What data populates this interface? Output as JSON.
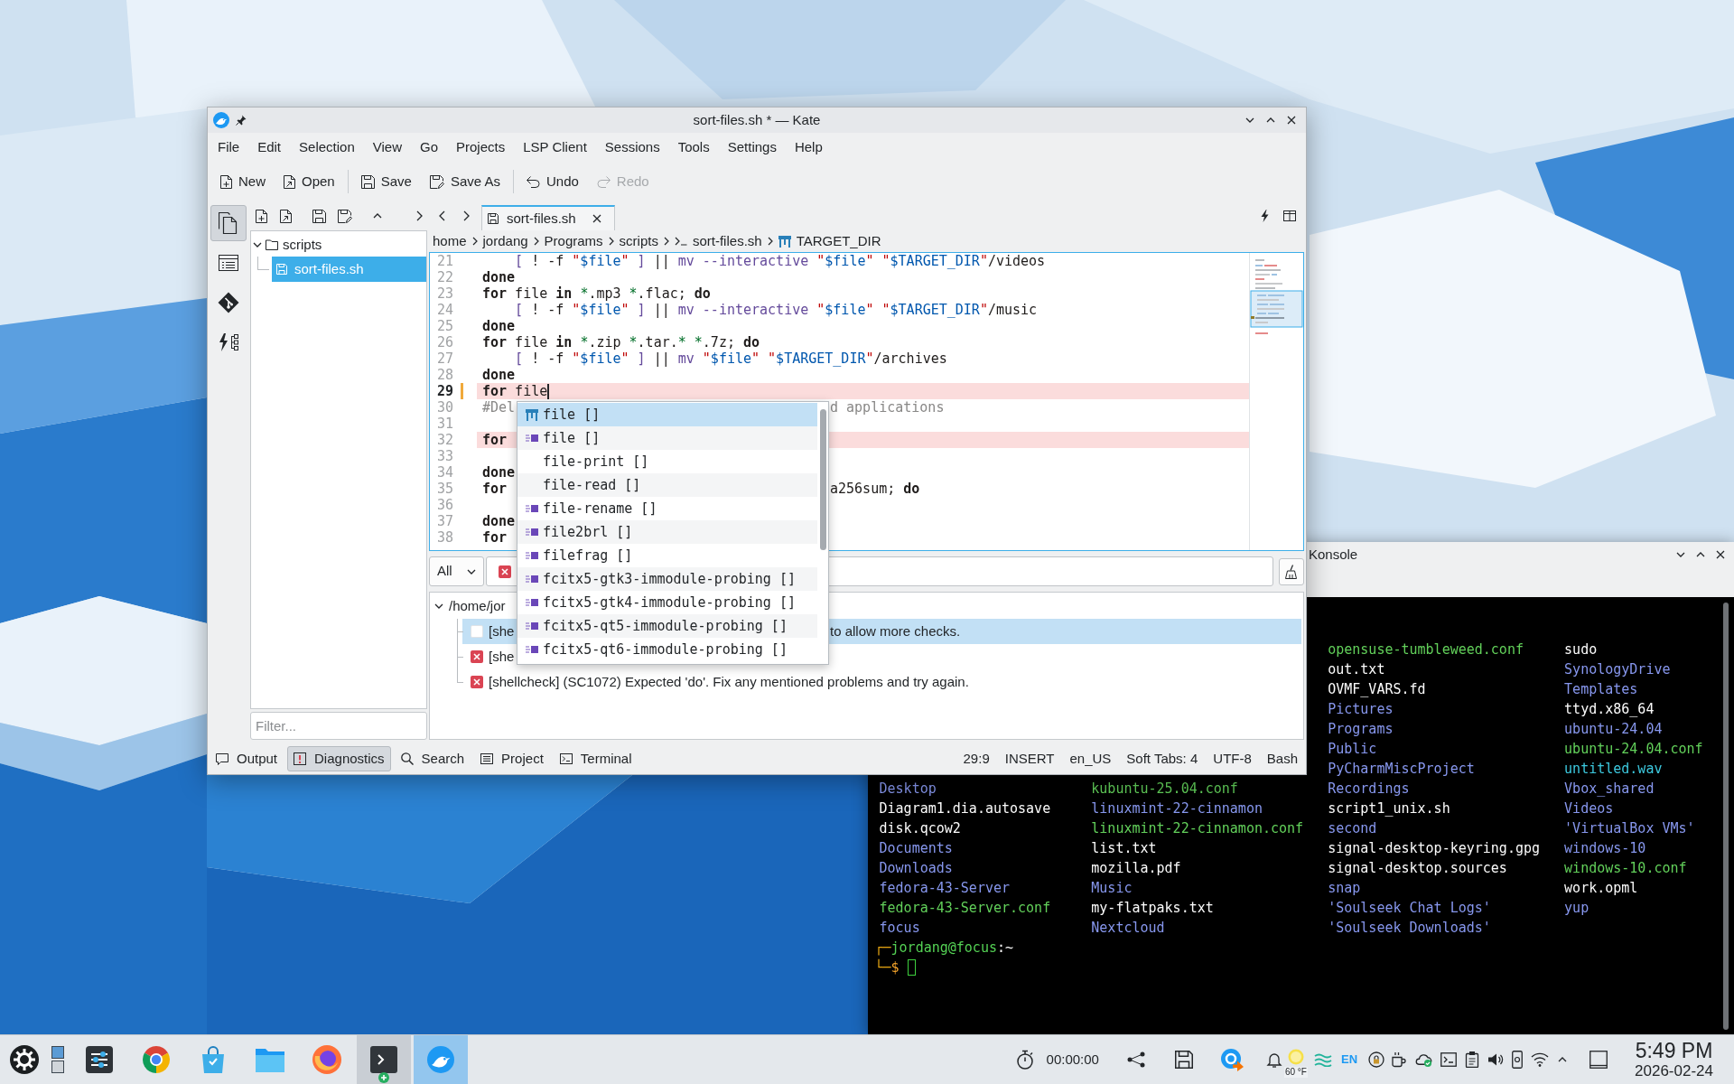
{
  "kate": {
    "title": "sort-files.sh * — Kate",
    "menu": [
      "File",
      "Edit",
      "Selection",
      "View",
      "Go",
      "Projects",
      "LSP Client",
      "Sessions",
      "Tools",
      "Settings",
      "Help"
    ],
    "toolbar": [
      [
        {
          "label": "New",
          "disabled": false
        },
        {
          "label": "Open",
          "disabled": false
        }
      ],
      [
        {
          "label": "Save",
          "disabled": false
        },
        {
          "label": "Save As",
          "disabled": false
        }
      ],
      [
        {
          "label": "Undo",
          "disabled": false
        },
        {
          "label": "Redo",
          "disabled": true
        }
      ]
    ],
    "side_buttons": [
      {
        "selected": true
      },
      {
        "selected": false
      },
      {
        "selected": false
      },
      {
        "selected": false
      }
    ],
    "file_tree": {
      "items": [
        {
          "label": "scripts",
          "expanded": true,
          "selected": false,
          "children": [
            {
              "label": "sort-files.sh",
              "selected": true
            }
          ]
        }
      ],
      "filter": {
        "placeholder": "Filter..."
      }
    },
    "tabs": [
      {
        "label": "sort-files.sh",
        "selected": true
      }
    ],
    "breadcrumb": [
      {
        "label": "home",
        "kind": "folder"
      },
      {
        "label": "jordang",
        "kind": "folder"
      },
      {
        "label": "Programs",
        "kind": "folder"
      },
      {
        "label": "scripts",
        "kind": "folder"
      },
      {
        "label": "sort-files.sh",
        "kind": "script"
      },
      {
        "label": "TARGET_DIR",
        "kind": "symbol"
      }
    ],
    "editor": {
      "lines": [
        {
          "number": "21",
          "indented": true,
          "error": false,
          "current": false,
          "modified": false,
          "tokens": [
            {
              "text": "[",
              "kind": "builtin"
            },
            {
              "text": " ! -f ",
              "kind": "plain"
            },
            {
              "text": "\"",
              "kind": "string"
            },
            {
              "text": "$file",
              "kind": "variable"
            },
            {
              "text": "\" ",
              "kind": "string"
            },
            {
              "text": "]",
              "kind": "builtin"
            },
            {
              "text": " || ",
              "kind": "plain"
            },
            {
              "text": "mv --interactive ",
              "kind": "builtin"
            },
            {
              "text": "\"",
              "kind": "string"
            },
            {
              "text": "$file",
              "kind": "variable"
            },
            {
              "text": "\" \"",
              "kind": "string"
            },
            {
              "text": "$TARGET_DIR",
              "kind": "variable"
            },
            {
              "text": "\"",
              "kind": "string"
            },
            {
              "text": "/videos",
              "kind": "plain"
            }
          ]
        },
        {
          "number": "22",
          "indented": false,
          "error": false,
          "current": false,
          "modified": false,
          "tokens": [
            {
              "text": "done",
              "kind": "keyword"
            }
          ]
        },
        {
          "number": "23",
          "indented": false,
          "error": false,
          "current": false,
          "modified": false,
          "tokens": [
            {
              "text": "for",
              "kind": "keyword"
            },
            {
              "text": " file ",
              "kind": "plain"
            },
            {
              "text": "in ",
              "kind": "keyword"
            },
            {
              "text": "*",
              "kind": "glob"
            },
            {
              "text": ".mp3 ",
              "kind": "plain"
            },
            {
              "text": "*",
              "kind": "glob"
            },
            {
              "text": ".flac; ",
              "kind": "plain"
            },
            {
              "text": "do",
              "kind": "keyword"
            }
          ]
        },
        {
          "number": "24",
          "indented": true,
          "error": false,
          "current": false,
          "modified": false,
          "tokens": [
            {
              "text": "[",
              "kind": "builtin"
            },
            {
              "text": " ! -f ",
              "kind": "plain"
            },
            {
              "text": "\"",
              "kind": "string"
            },
            {
              "text": "$file",
              "kind": "variable"
            },
            {
              "text": "\" ",
              "kind": "string"
            },
            {
              "text": "]",
              "kind": "builtin"
            },
            {
              "text": " || ",
              "kind": "plain"
            },
            {
              "text": "mv --interactive ",
              "kind": "builtin"
            },
            {
              "text": "\"",
              "kind": "string"
            },
            {
              "text": "$file",
              "kind": "variable"
            },
            {
              "text": "\" \"",
              "kind": "string"
            },
            {
              "text": "$TARGET_DIR",
              "kind": "variable"
            },
            {
              "text": "\"",
              "kind": "string"
            },
            {
              "text": "/music",
              "kind": "plain"
            }
          ]
        },
        {
          "number": "25",
          "indented": false,
          "error": false,
          "current": false,
          "modified": false,
          "tokens": [
            {
              "text": "done",
              "kind": "keyword"
            }
          ]
        },
        {
          "number": "26",
          "indented": false,
          "error": false,
          "current": false,
          "modified": false,
          "tokens": [
            {
              "text": "for",
              "kind": "keyword"
            },
            {
              "text": " file ",
              "kind": "plain"
            },
            {
              "text": "in ",
              "kind": "keyword"
            },
            {
              "text": "*",
              "kind": "glob"
            },
            {
              "text": ".zip ",
              "kind": "plain"
            },
            {
              "text": "*",
              "kind": "glob"
            },
            {
              "text": ".tar.",
              "kind": "plain"
            },
            {
              "text": "* *",
              "kind": "glob"
            },
            {
              "text": ".7z; ",
              "kind": "plain"
            },
            {
              "text": "do",
              "kind": "keyword"
            }
          ]
        },
        {
          "number": "27",
          "indented": true,
          "error": false,
          "current": false,
          "modified": false,
          "tokens": [
            {
              "text": "[",
              "kind": "builtin"
            },
            {
              "text": " ! -f ",
              "kind": "plain"
            },
            {
              "text": "\"",
              "kind": "string"
            },
            {
              "text": "$file",
              "kind": "variable"
            },
            {
              "text": "\" ",
              "kind": "string"
            },
            {
              "text": "]",
              "kind": "builtin"
            },
            {
              "text": " || ",
              "kind": "plain"
            },
            {
              "text": "mv ",
              "kind": "builtin"
            },
            {
              "text": "\"",
              "kind": "string"
            },
            {
              "text": "$file",
              "kind": "variable"
            },
            {
              "text": "\" \"",
              "kind": "string"
            },
            {
              "text": "$TARGET_DIR",
              "kind": "variable"
            },
            {
              "text": "\"",
              "kind": "string"
            },
            {
              "text": "/archives",
              "kind": "plain"
            }
          ]
        },
        {
          "number": "28",
          "indented": false,
          "error": false,
          "current": false,
          "modified": false,
          "tokens": [
            {
              "text": "done",
              "kind": "keyword"
            }
          ]
        },
        {
          "number": "29",
          "indented": false,
          "error": true,
          "current": true,
          "modified": true,
          "tokens": [
            {
              "text": "for",
              "kind": "keyword"
            },
            {
              "text": " file",
              "kind": "plain"
            }
          ]
        },
        {
          "number": "30",
          "indented": false,
          "error": false,
          "current": false,
          "modified": false,
          "tokens": [
            {
              "text": "#Del",
              "kind": "comment"
            }
          ],
          "after": [
            {
              "text": "d applications",
              "kind": "comment"
            }
          ]
        },
        {
          "number": "31",
          "error": false,
          "current": false,
          "modified": false
        },
        {
          "number": "32",
          "indented": false,
          "error": true,
          "current": false,
          "modified": false,
          "tokens": [
            {
              "text": "for",
              "kind": "keyword"
            }
          ]
        },
        {
          "number": "33",
          "error": false,
          "current": false,
          "modified": false
        },
        {
          "number": "34",
          "indented": false,
          "error": false,
          "current": false,
          "modified": false,
          "tokens": [
            {
              "text": "done",
              "kind": "keyword"
            }
          ]
        },
        {
          "number": "35",
          "indented": false,
          "error": false,
          "current": false,
          "modified": false,
          "tokens": [
            {
              "text": "for",
              "kind": "keyword"
            }
          ],
          "after": [
            {
              "text": "a256sum; ",
              "kind": "plain"
            },
            {
              "text": "do",
              "kind": "keyword"
            }
          ]
        },
        {
          "number": "36",
          "error": false,
          "current": false,
          "modified": false
        },
        {
          "number": "37",
          "indented": false,
          "error": false,
          "current": false,
          "modified": false,
          "tokens": [
            {
              "text": "done",
              "kind": "keyword"
            }
          ]
        },
        {
          "number": "38",
          "indented": false,
          "error": false,
          "current": false,
          "modified": false,
          "tokens": [
            {
              "text": "for",
              "kind": "keyword"
            }
          ]
        }
      ]
    },
    "completion": {
      "items": [
        {
          "label": "file []",
          "kind": "variable",
          "selected": true
        },
        {
          "label": "file []",
          "kind": "function",
          "selected": false
        },
        {
          "label": "file-print []",
          "kind": "word",
          "selected": false
        },
        {
          "label": "file-read []",
          "kind": "word",
          "selected": false
        },
        {
          "label": "file-rename []",
          "kind": "function",
          "selected": false
        },
        {
          "label": "file2brl []",
          "kind": "function",
          "selected": false
        },
        {
          "label": "filefrag []",
          "kind": "function",
          "selected": false
        },
        {
          "label": "fcitx5-gtk3-immodule-probing []",
          "kind": "function",
          "selected": false
        },
        {
          "label": "fcitx5-gtk4-immodule-probing []",
          "kind": "function",
          "selected": false
        },
        {
          "label": "fcitx5-qt5-immodule-probing []",
          "kind": "function",
          "selected": false
        },
        {
          "label": "fcitx5-qt6-immodule-probing []",
          "kind": "function",
          "selected": false
        }
      ]
    },
    "diagnostics": {
      "scope": "All",
      "tree": [
        {
          "label": "/home/jor",
          "expanded": true,
          "children": [
            {
              "kind": "note",
              "text": "[she",
              "after": "to allow more checks.",
              "selected": true
            },
            {
              "kind": "error",
              "text": "[she",
              "selected": false
            },
            {
              "kind": "error",
              "text": "[shellcheck] (SC1072) Expected 'do'. Fix any mentioned problems and try again.",
              "selected": false
            }
          ]
        }
      ]
    },
    "bottom_tabs": [
      {
        "label": "Output",
        "selected": false
      },
      {
        "label": "Diagnostics",
        "selected": true
      },
      {
        "label": "Search",
        "selected": false
      },
      {
        "label": "Project",
        "selected": false
      },
      {
        "label": "Terminal",
        "selected": false
      }
    ],
    "status": [
      "29:9",
      "INSERT",
      "en_US",
      "Soft Tabs: 4",
      "UTF-8",
      "Bash"
    ]
  },
  "konsole": {
    "title": "Konsole",
    "listing": [
      {
        "entries": [
          {
            "name": "Desktop",
            "kind": "dir"
          },
          {
            "name": "Diagram1.dia.autosave",
            "kind": "file"
          },
          {
            "name": "disk.qcow2",
            "kind": "file"
          },
          {
            "name": "Documents",
            "kind": "dir"
          },
          {
            "name": "Downloads",
            "kind": "dir"
          },
          {
            "name": "fedora-43-Server",
            "kind": "dir"
          },
          {
            "name": "fedora-43-Server.conf",
            "kind": "conf"
          },
          {
            "name": "focus",
            "kind": "dir"
          }
        ]
      },
      {
        "entries": [
          {
            "name": "kubuntu-25.04.conf",
            "kind": "conf"
          },
          {
            "name": "linuxmint-22-cinnamon",
            "kind": "dir"
          },
          {
            "name": "linuxmint-22-cinnamon.conf",
            "kind": "conf"
          },
          {
            "name": "list.txt",
            "kind": "file"
          },
          {
            "name": "mozilla.pdf",
            "kind": "file"
          },
          {
            "name": "Music",
            "kind": "dir"
          },
          {
            "name": "my-flatpaks.txt",
            "kind": "file"
          },
          {
            "name": "Nextcloud",
            "kind": "dir"
          }
        ]
      },
      {
        "entries": [
          {
            "name": "opensuse-tumbleweed.conf",
            "kind": "conf"
          },
          {
            "name": "out.txt",
            "kind": "file"
          },
          {
            "name": "OVMF_VARS.fd",
            "kind": "file"
          },
          {
            "name": "Pictures",
            "kind": "dir"
          },
          {
            "name": "Programs",
            "kind": "dir"
          },
          {
            "name": "Public",
            "kind": "dir"
          },
          {
            "name": "PyCharmMiscProject",
            "kind": "dir"
          },
          {
            "name": "Recordings",
            "kind": "dir"
          },
          {
            "name": "script1_unix.sh",
            "kind": "file"
          },
          {
            "name": "second",
            "kind": "dir"
          },
          {
            "name": "signal-desktop-keyring.gpg",
            "kind": "file"
          },
          {
            "name": "signal-desktop.sources",
            "kind": "file"
          },
          {
            "name": "snap",
            "kind": "dir"
          },
          {
            "name": "'Soulseek Chat Logs'",
            "kind": "dir"
          },
          {
            "name": "'Soulseek Downloads'",
            "kind": "dir"
          }
        ]
      },
      {
        "entries": [
          {
            "name": "sudo",
            "kind": "file"
          },
          {
            "name": "SynologyDrive",
            "kind": "dir"
          },
          {
            "name": "Templates",
            "kind": "dir"
          },
          {
            "name": "ttyd.x86_64",
            "kind": "file"
          },
          {
            "name": "ubuntu-24.04",
            "kind": "dir"
          },
          {
            "name": "ubuntu-24.04.conf",
            "kind": "conf"
          },
          {
            "name": "untitled.wav",
            "kind": "audio"
          },
          {
            "name": "Vbox_shared",
            "kind": "dir"
          },
          {
            "name": "Videos",
            "kind": "dir"
          },
          {
            "name": "'VirtualBox VMs'",
            "kind": "dir"
          },
          {
            "name": "windows-10",
            "kind": "dir"
          },
          {
            "name": "windows-10.conf",
            "kind": "conf"
          },
          {
            "name": "work.opml",
            "kind": "file"
          },
          {
            "name": "yup",
            "kind": "dir"
          }
        ]
      }
    ],
    "prompt": [
      {
        "segments": [
          {
            "text": "┌─",
            "kind": "frame"
          },
          {
            "text": "jordang@focus",
            "kind": "user"
          },
          {
            "text": ":~",
            "kind": "path"
          }
        ],
        "cursor": false
      },
      {
        "segments": [
          {
            "text": "└─",
            "kind": "frame"
          },
          {
            "text": "$",
            "kind": "sigil"
          }
        ],
        "cursor": true
      }
    ]
  },
  "taskbar": {
    "apps": [
      {
        "running": false,
        "selected": false,
        "badge": false
      },
      {
        "running": false,
        "selected": false,
        "badge": false
      },
      {
        "running": false,
        "selected": false,
        "badge": false
      },
      {
        "running": false,
        "selected": false,
        "badge": false
      },
      {
        "running": false,
        "selected": false,
        "badge": false
      },
      {
        "running": true,
        "selected": false,
        "badge": true
      },
      {
        "running": true,
        "selected": true,
        "badge": false
      }
    ],
    "timer": "00:00:00",
    "weather": "60 °F",
    "keyboard_layout": "EN",
    "clock": {
      "time": "5:49 PM",
      "date": "2026-02-24"
    }
  }
}
